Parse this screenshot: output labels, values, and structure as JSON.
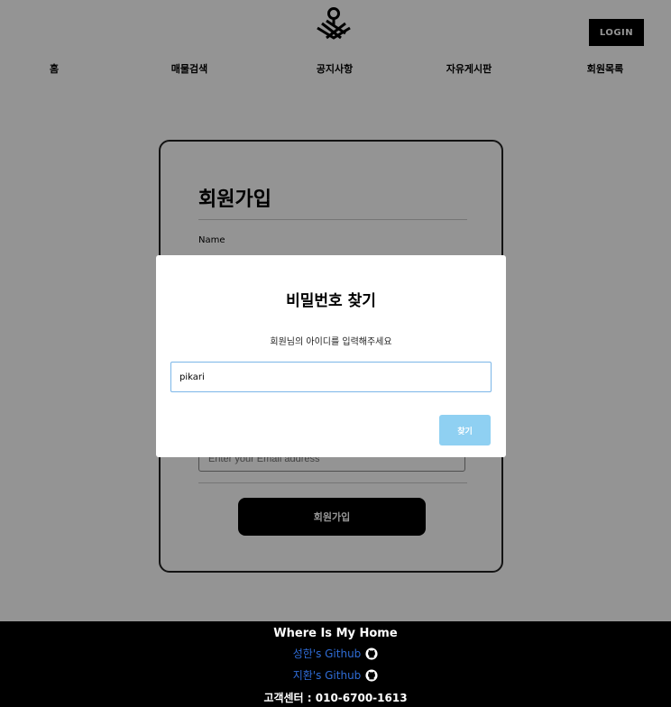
{
  "header": {
    "login_label": "LOGIN",
    "nav": [
      {
        "label": "홈"
      },
      {
        "label": "매물검색"
      },
      {
        "label": "공지사항"
      },
      {
        "label": "자유게시판"
      },
      {
        "label": "회원목록"
      }
    ]
  },
  "signup": {
    "title": "회원가입",
    "name_label": "Name",
    "email_placeholder": "Enter your Email address",
    "submit_label": "회원가입"
  },
  "modal": {
    "title": "비밀번호 찾기",
    "description": "회원님의 아이디를 입력해주세요",
    "input_value": "pikari",
    "button_label": "찾기"
  },
  "footer": {
    "title": "Where Is My Home",
    "link1": "성한's Github",
    "link2": "지환's Github",
    "contact": "고객센터 : 010-6700-1613"
  },
  "colors": {
    "overlay": "#000000",
    "link": "#2f6cd6",
    "modal_button": "#8fd0f2",
    "modal_input_border": "#7bb6e8"
  }
}
